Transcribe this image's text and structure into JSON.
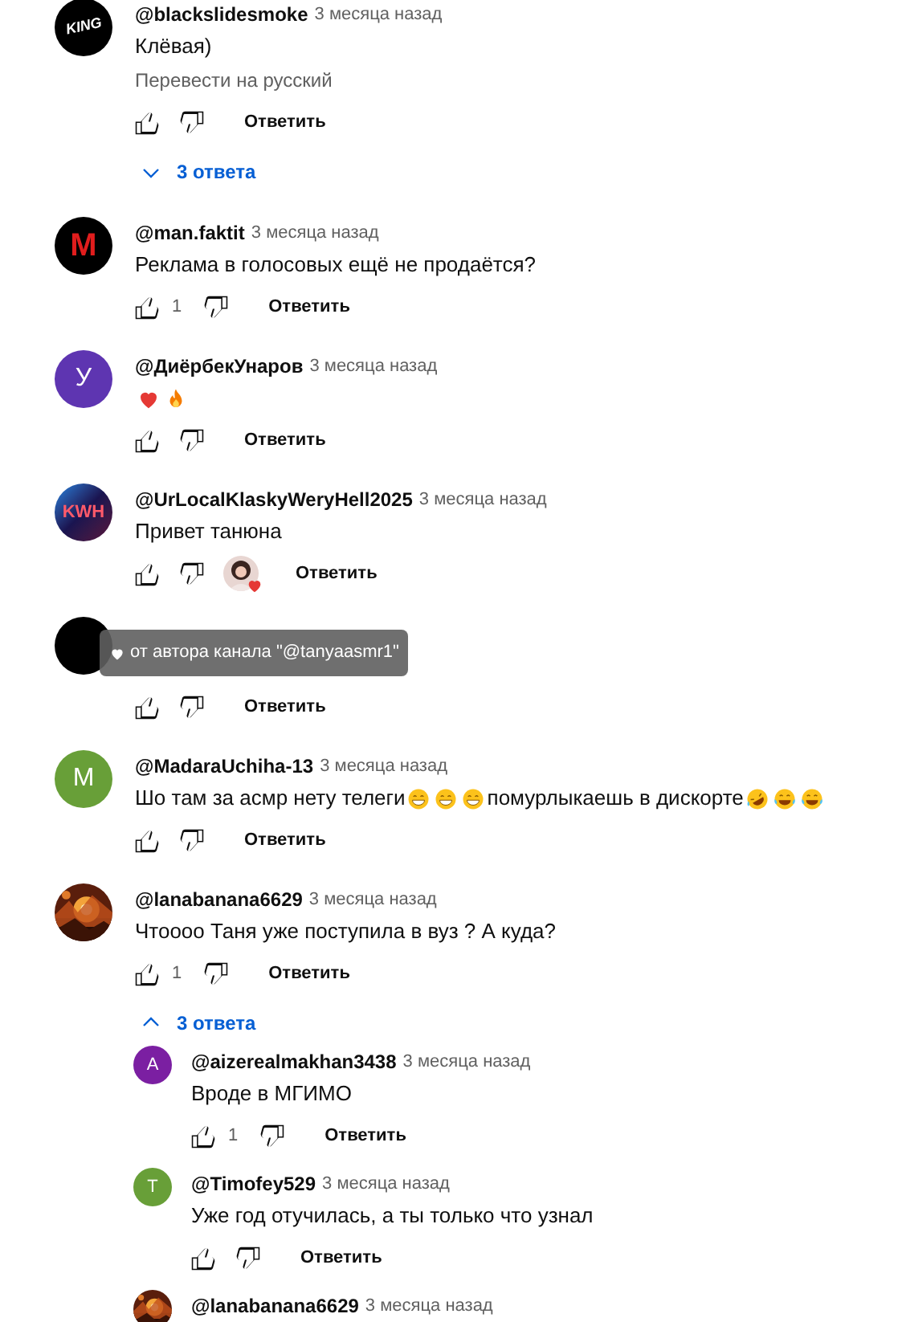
{
  "comments": [
    {
      "author": "@blackslidesmoke",
      "time": "3 месяца назад",
      "avatar": {
        "kind": "tilted",
        "label": "KING",
        "color": "#000000"
      },
      "text": "Клёвая)",
      "translate": "Перевести на русский",
      "reply_label": "Ответить",
      "replies_toggle": {
        "label": "3 ответа",
        "expanded": false
      }
    },
    {
      "author": "@man.faktit",
      "time": "3 месяца назад",
      "avatar": {
        "kind": "block",
        "label": "M",
        "color": "#000000"
      },
      "text": "Реклама в голосовых ещё не продаётся?",
      "likes": "1",
      "reply_label": "Ответить"
    },
    {
      "author": "@ДиёрбекУнаров",
      "time": "3 месяца назад",
      "avatar": {
        "kind": "letter",
        "label": "У",
        "color": "#5e35b1"
      },
      "parts": [
        {
          "kind": "heart"
        },
        {
          "kind": "fire"
        }
      ],
      "reply_label": "Ответить"
    },
    {
      "author": "@UrLocalKlaskyWeryHell2025",
      "time": "3 месяца назад",
      "avatar": {
        "kind": "gradient",
        "label": "KWH"
      },
      "text": "Привет танюна",
      "reply_label": "Ответить",
      "creator_heart": true
    },
    {
      "avatar": {
        "kind": "plain",
        "color": "#000000"
      },
      "reply_label": "Ответить",
      "tooltip": "от автора канала \"@tanyaasmr1\""
    },
    {
      "author": "@MadaraUchiha-13",
      "time": "3 месяца назад",
      "avatar": {
        "kind": "letter",
        "label": "M",
        "color": "#689f38"
      },
      "parts": [
        {
          "kind": "text",
          "text": "Шо там за асмр нету телеги"
        },
        {
          "kind": "grin"
        },
        {
          "kind": "grin"
        },
        {
          "kind": "grin"
        },
        {
          "kind": "text",
          "text": "помурлыкаешь в дискорте"
        },
        {
          "kind": "rofl"
        },
        {
          "kind": "joy"
        },
        {
          "kind": "joy"
        }
      ],
      "reply_label": "Ответить"
    },
    {
      "author": "@lanabanana6629",
      "time": "3 месяца назад",
      "text": "Чтоооо Таня уже поступила в вуз ? А куда?",
      "likes": "1",
      "reply_label": "Ответить",
      "replies_toggle": {
        "label": "3 ответа",
        "expanded": true
      },
      "replies": [
        {
          "author": "@aizerealmakhan3438",
          "time": "3 месяца назад",
          "avatar": {
            "kind": "letter",
            "label": "A",
            "color": "#7b1fa2"
          },
          "text": "Вроде в МГИМО",
          "likes": "1",
          "reply_label": "Ответить"
        },
        {
          "author": "@Timofey529",
          "time": "3 месяца назад",
          "avatar": {
            "kind": "letter",
            "label": "T",
            "color": "#689f38"
          },
          "text": "Уже год отучилась, а ты только что узнал",
          "reply_label": "Ответить"
        },
        {
          "author": "@lanabanana6629",
          "time": "3 месяца назад"
        }
      ]
    }
  ]
}
